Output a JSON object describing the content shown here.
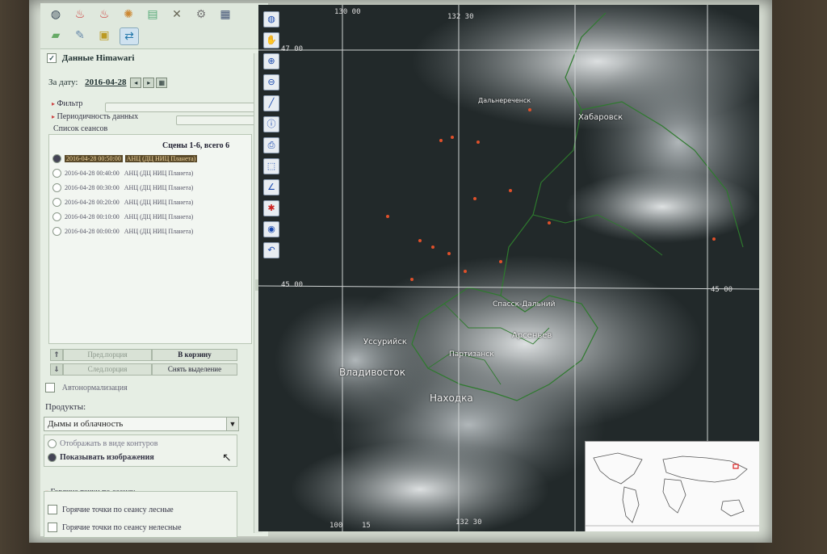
{
  "toolbar": {
    "icons": [
      "globe-icon",
      "fire-icon",
      "fire-building-icon",
      "fire-cluster-icon",
      "layers-icon",
      "tools-icon",
      "settings-icon",
      "table-icon",
      "map-tile-icon",
      "map-edit-icon",
      "boxes-icon",
      "share-icon"
    ]
  },
  "himawari": {
    "title": "Данные Himawari",
    "checked": "✓",
    "date_label": "За дату:",
    "date_value": "2016-04-28"
  },
  "filters": {
    "filter_label": "Фильтр",
    "period_label": "Периодичность данных",
    "sessions_label": "Список сеансов"
  },
  "scenes": {
    "summary": "Сцены 1-6, всего 6",
    "items": [
      {
        "time": "2016-04-28 00:50:00",
        "source": "АНЦ (ДЦ НИЦ Планета)"
      },
      {
        "time": "2016-04-28 00:40:00",
        "source": "АНЦ (ДЦ НИЦ Планета)"
      },
      {
        "time": "2016-04-28 00:30:00",
        "source": "АНЦ (ДЦ НИЦ Планета)"
      },
      {
        "time": "2016-04-28 00:20:00",
        "source": "АНЦ (ДЦ НИЦ Планета)"
      },
      {
        "time": "2016-04-28 00:10:00",
        "source": "АНЦ (ДЦ НИЦ Планета)"
      },
      {
        "time": "2016-04-28 00:00:00",
        "source": "АНЦ (ДЦ НИЦ Планета)"
      }
    ]
  },
  "buttons": {
    "prev": "Пред.порция",
    "next": "След.порция",
    "to_cart": "В корзину",
    "clear": "Снять выделение"
  },
  "auto_norm": "Автонормализация",
  "products": {
    "label": "Продукты:",
    "selected": "Дымы и облачность",
    "show_contours": "Отображать в виде контуров",
    "show_images": "Показывать изображения"
  },
  "hotspots": {
    "title": "Горячие точки по сеансу",
    "forest": "Горячие точки по сеансу лесные",
    "nonforest": "Горячие точки по сеансу нелесные"
  },
  "map": {
    "tools": [
      "globe-icon",
      "pan-icon",
      "zoom-in-icon",
      "zoom-out-icon",
      "ruler-icon",
      "info-icon",
      "print-icon",
      "select-icon",
      "line-icon",
      "pin-icon",
      "sphere-icon",
      "undo-icon"
    ],
    "coords": {
      "lon130": "130 00",
      "lon132_top": "132 30",
      "lat47": "47 00",
      "lat45_left": "45 00",
      "lat45_right": "45 00",
      "lon_bottom_left": "100",
      "lon_bottom_mid": "15",
      "lon132_bottom": "132 30"
    },
    "cities": {
      "vladivostok": "Владивосток",
      "nakhodka": "Находка",
      "ussuriysk": "Уссурийск",
      "arsenyev": "Арсеньев",
      "khabarovsk": "Хабаровск",
      "dalnerechensk": "Дальнереченск",
      "partizansk": "Партизанск",
      "spassk": "Спасск-Дальний"
    }
  }
}
